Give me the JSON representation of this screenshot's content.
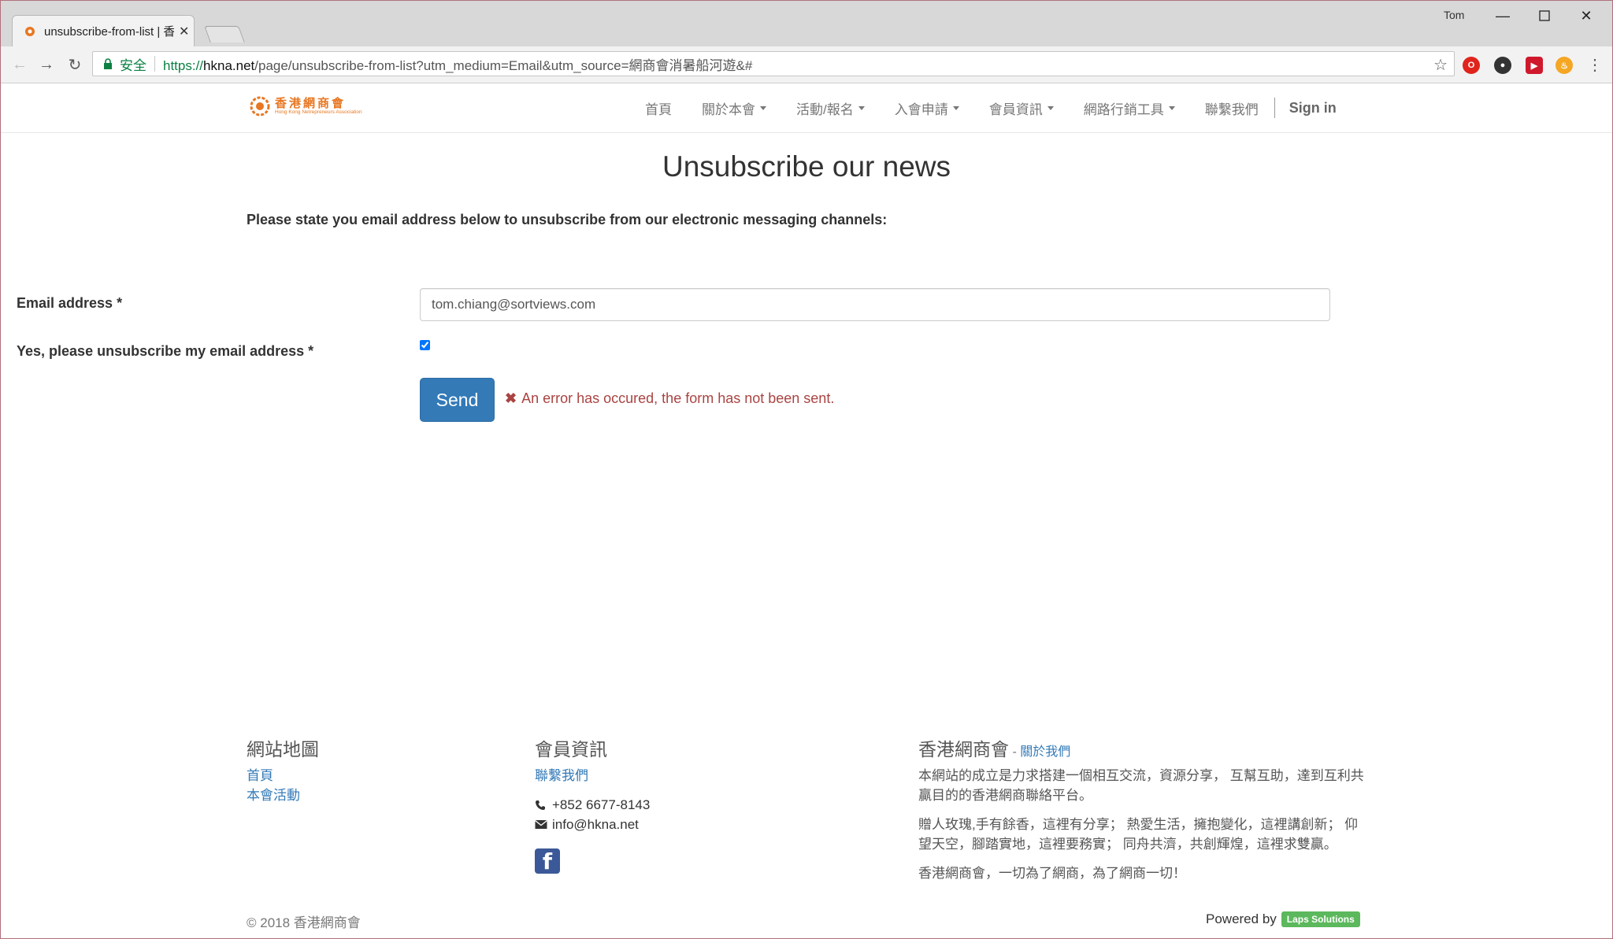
{
  "browser": {
    "tab_title": "unsubscribe-from-list | 香",
    "profile_name": "Tom",
    "secure_label": "安全",
    "url_scheme": "https://",
    "url_host": "hkna.net",
    "url_path": "/page/unsubscribe-from-list?utm_medium=Email&utm_source=網商會消暑船河遊&#"
  },
  "site": {
    "logo_cn": "香港網商會",
    "logo_en": "Hong Kong Netrepreneurs Association",
    "nav": [
      {
        "label": "首頁",
        "dropdown": false
      },
      {
        "label": "關於本會",
        "dropdown": true
      },
      {
        "label": "活動/報名",
        "dropdown": true
      },
      {
        "label": "入會申請",
        "dropdown": true
      },
      {
        "label": "會員資訊",
        "dropdown": true
      },
      {
        "label": "網路行銷工具",
        "dropdown": true
      },
      {
        "label": "聯繫我們",
        "dropdown": false
      }
    ],
    "sign_in": "Sign in"
  },
  "form": {
    "title": "Unsubscribe our news",
    "intro": "Please state you email address below to unsubscribe from our electronic messaging channels:",
    "email_label": "Email address *",
    "email_value": "tom.chiang@sortviews.com",
    "confirm_label": "Yes, please unsubscribe my email address *",
    "confirm_checked": true,
    "send_label": "Send",
    "error_message": "An error has occured, the form has not been sent."
  },
  "footer": {
    "sitemap_title": "網站地圖",
    "sitemap_links": [
      "首頁",
      "本會活動"
    ],
    "member_title": "會員資訊",
    "contact_link": "聯繫我們",
    "phone": "+852 6677-8143",
    "email": "info@hkna.net",
    "about_title": "香港網商會",
    "about_sep": " - ",
    "about_link": "關於我們",
    "about_p1": "本網站的成立是力求搭建一個相互交流，資源分享， 互幫互助，達到互利共贏目的的香港網商聯絡平台。",
    "about_p2": "贈人玫瑰,手有餘香，這裡有分享； 熱愛生活，擁抱變化，這裡講創新； 仰望天空，腳踏實地，這裡要務實； 同舟共濟，共創輝煌，這裡求雙贏。",
    "about_p3": "香港網商會，一切為了網商，為了網商一切！",
    "copyright": "© 2018 香港網商會",
    "powered_by": "Powered by",
    "powered_badge": "Laps Solutions"
  },
  "colors": {
    "brand_orange": "#e87722",
    "link_blue": "#337ab7",
    "button_blue": "#337ab7",
    "error_red": "#a94442",
    "secure_green": "#0b8043",
    "badge_green": "#5cb85c"
  },
  "icons": [
    "back-arrow-icon",
    "forward-arrow-icon",
    "reload-icon",
    "lock-icon",
    "star-icon",
    "phone-icon",
    "envelope-icon",
    "facebook-icon",
    "close-icon"
  ]
}
